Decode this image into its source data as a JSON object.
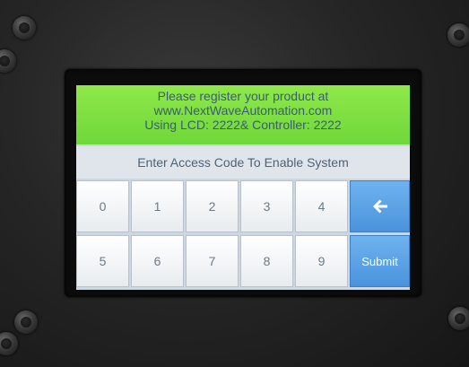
{
  "banner": {
    "line1": "Please register your product at",
    "line2": "www.NextWaveAutomation.com",
    "line3": "Using LCD: 2222& Controller: 2222"
  },
  "prompt": "Enter Access Code To Enable System",
  "keypad": {
    "row1": [
      "0",
      "1",
      "2",
      "3",
      "4"
    ],
    "row2": [
      "5",
      "6",
      "7",
      "8",
      "9"
    ],
    "backspace_icon": "left-arrow-icon",
    "submit_label": "Submit"
  },
  "colors": {
    "banner": "#7be03f",
    "banner_text": "#3c5a7a",
    "action_key": "#4a93dc",
    "key_text": "#6b7a88"
  }
}
